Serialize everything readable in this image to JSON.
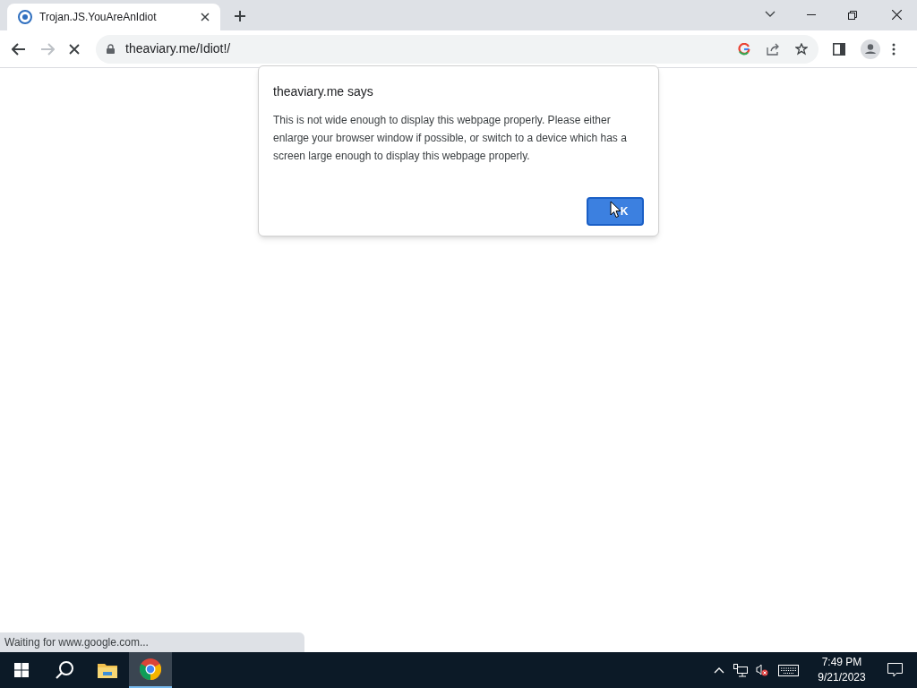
{
  "tab": {
    "title": "Trojan.JS.YouAreAnIdiot",
    "selected": true
  },
  "address_bar": {
    "url": "theaviary.me/Idiot!/",
    "loading": true
  },
  "dialog": {
    "title": "theaviary.me says",
    "message": "This is not wide enough to display this webpage properly. Please either enlarge your browser window if possible, or switch to a device which has a screen large enough to display this webpage properly.",
    "button": "K"
  },
  "status_bubble": "Waiting for www.google.com...",
  "taskbar": {
    "apps": [
      {
        "kind": "explorer",
        "selected": false
      },
      {
        "kind": "chrome",
        "selected": true
      }
    ],
    "time": "7:49 PM",
    "date": "9/21/2023"
  }
}
